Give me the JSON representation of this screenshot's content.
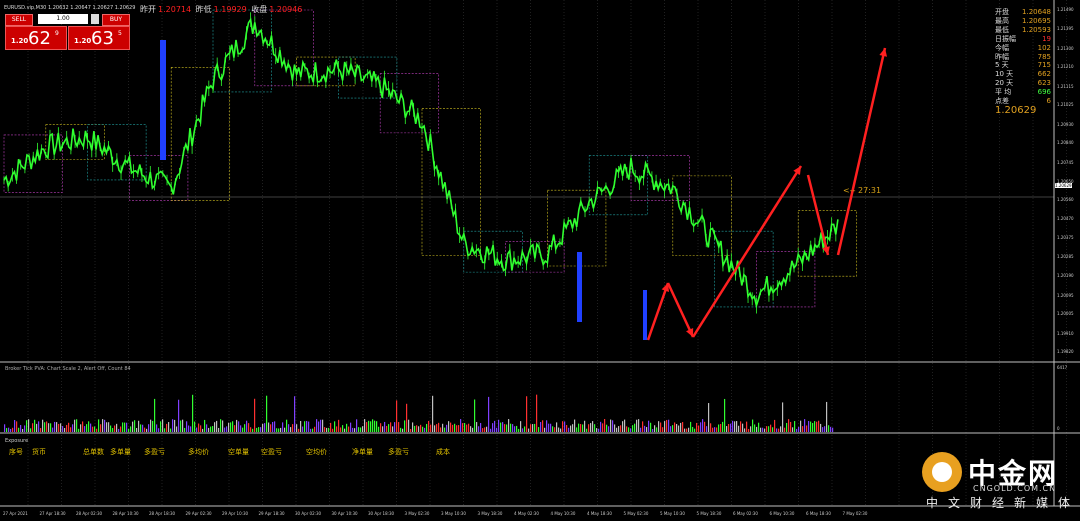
{
  "header": {
    "symbol_line": "EURUSD.vip,M30  1.20632 1.20647 1.20627 1.20629",
    "open_label": "昨开",
    "open_value": "1.20714",
    "low_label": "昨低",
    "low_value": "1.19929",
    "close_label": "收盘",
    "close_value": "1.20946"
  },
  "trade_panel": {
    "sell_label": "SELL",
    "buy_label": "BUY",
    "lot": "1.00",
    "sell_small": "1.20",
    "sell_big": "62",
    "sell_sup": "9",
    "buy_small": "1.20",
    "buy_big": "63",
    "buy_sup": "5"
  },
  "info_panel": {
    "rows": [
      {
        "label": "开盘",
        "value": "1.20648",
        "color": "#e0a020"
      },
      {
        "label": "最高",
        "value": "1.20695",
        "color": "#e0a020"
      },
      {
        "label": "最低",
        "value": "1.20593",
        "color": "#e0a020"
      },
      {
        "label": "日振幅",
        "value": "19",
        "color": "#ff3030"
      },
      {
        "label": "今幅",
        "value": "102",
        "color": "#e0a020"
      },
      {
        "label": "昨幅",
        "value": "785",
        "color": "#e0a020"
      },
      {
        "label": "5 天",
        "value": "715",
        "color": "#e0a020"
      },
      {
        "label": "10 天",
        "value": "662",
        "color": "#e0a020"
      },
      {
        "label": "20 天",
        "value": "623",
        "color": "#e0a020"
      },
      {
        "label": "平 均",
        "value": "696",
        "color": "#40ff40"
      },
      {
        "label": "点差",
        "value": "6",
        "color": "#e0a020"
      }
    ],
    "current_price": "1.20629"
  },
  "countdown": "<-- 27:31",
  "price_ticks": [
    {
      "label": "1.21490",
      "price": 1.2149
    },
    {
      "label": "1.21395",
      "price": 1.21395
    },
    {
      "label": "1.21300",
      "price": 1.213
    },
    {
      "label": "1.21210",
      "price": 1.2121
    },
    {
      "label": "1.21115",
      "price": 1.21115
    },
    {
      "label": "1.21025",
      "price": 1.21025
    },
    {
      "label": "1.20930",
      "price": 1.2093
    },
    {
      "label": "1.20840",
      "price": 1.2084
    },
    {
      "label": "1.20745",
      "price": 1.20745
    },
    {
      "label": "1.20650",
      "price": 1.2065
    },
    {
      "label": "1.20629",
      "price": 1.20629
    },
    {
      "label": "1.20560",
      "price": 1.2056
    },
    {
      "label": "1.20470",
      "price": 1.2047
    },
    {
      "label": "1.20375",
      "price": 1.20375
    },
    {
      "label": "1.20285",
      "price": 1.20285
    },
    {
      "label": "1.20190",
      "price": 1.2019
    },
    {
      "label": "1.20095",
      "price": 1.20095
    },
    {
      "label": "1.20005",
      "price": 1.20005
    },
    {
      "label": "1.19910",
      "price": 1.1991
    },
    {
      "label": "1.19820",
      "price": 1.1982
    }
  ],
  "indicator": {
    "label": "Broker Tick PVA:  Chart Scale 2, Alert Off,  Count 84",
    "scale_top": "6417",
    "scale_bottom": "0"
  },
  "exposure": {
    "label": "Exposure",
    "columns": [
      "序号",
      "货币",
      "总单数",
      "多单量",
      "多盈亏",
      "多均价",
      "空单量",
      "空盈亏",
      "空均价",
      "净单量",
      "多盈亏",
      "成本"
    ]
  },
  "time_axis": [
    "27 Apr 2021",
    "27 Apr 18:30",
    "28 Apr 02:30",
    "28 Apr 10:30",
    "28 Apr 18:30",
    "29 Apr 02:30",
    "29 Apr 10:30",
    "29 Apr 18:30",
    "30 Apr 02:30",
    "30 Apr 10:30",
    "30 Apr 18:30",
    "3 May 02:30",
    "3 May 10:30",
    "3 May 18:30",
    "4 May 02:30",
    "4 May 10:30",
    "4 May 18:30",
    "5 May 02:30",
    "5 May 10:30",
    "5 May 18:30",
    "6 May 02:30",
    "6 May 10:30",
    "6 May 18:30",
    "7 May 02:30"
  ],
  "logo": {
    "title": "中金网",
    "domain": "CNGOLD.COM.CN",
    "subtitle": "中文财经新媒体"
  },
  "colors": {
    "bull": "#30ff30",
    "bear_block": "#2040ff",
    "box_magenta": "#c040c0",
    "box_yellow": "#d0c020",
    "box_teal": "#20a0a0",
    "arrow": "#ff2020",
    "grid": "#404040"
  },
  "chart_data": {
    "type": "candlestick",
    "symbol": "EURUSD.vip",
    "timeframe": "M30",
    "ylim": [
      1.1982,
      1.2149
    ],
    "current_price": 1.20629,
    "x": [
      0,
      5,
      10,
      15,
      20,
      25,
      30,
      35,
      40,
      45,
      50,
      55,
      60,
      65,
      70,
      75,
      80,
      85,
      90,
      95,
      100
    ],
    "close": [
      1.2066,
      1.2082,
      1.2087,
      1.2072,
      1.2062,
      1.2115,
      1.2143,
      1.2118,
      1.212,
      1.2112,
      1.2095,
      1.2035,
      1.2027,
      1.203,
      1.2055,
      1.2072,
      1.2062,
      1.2035,
      1.201,
      1.2025,
      1.2045
    ]
  }
}
